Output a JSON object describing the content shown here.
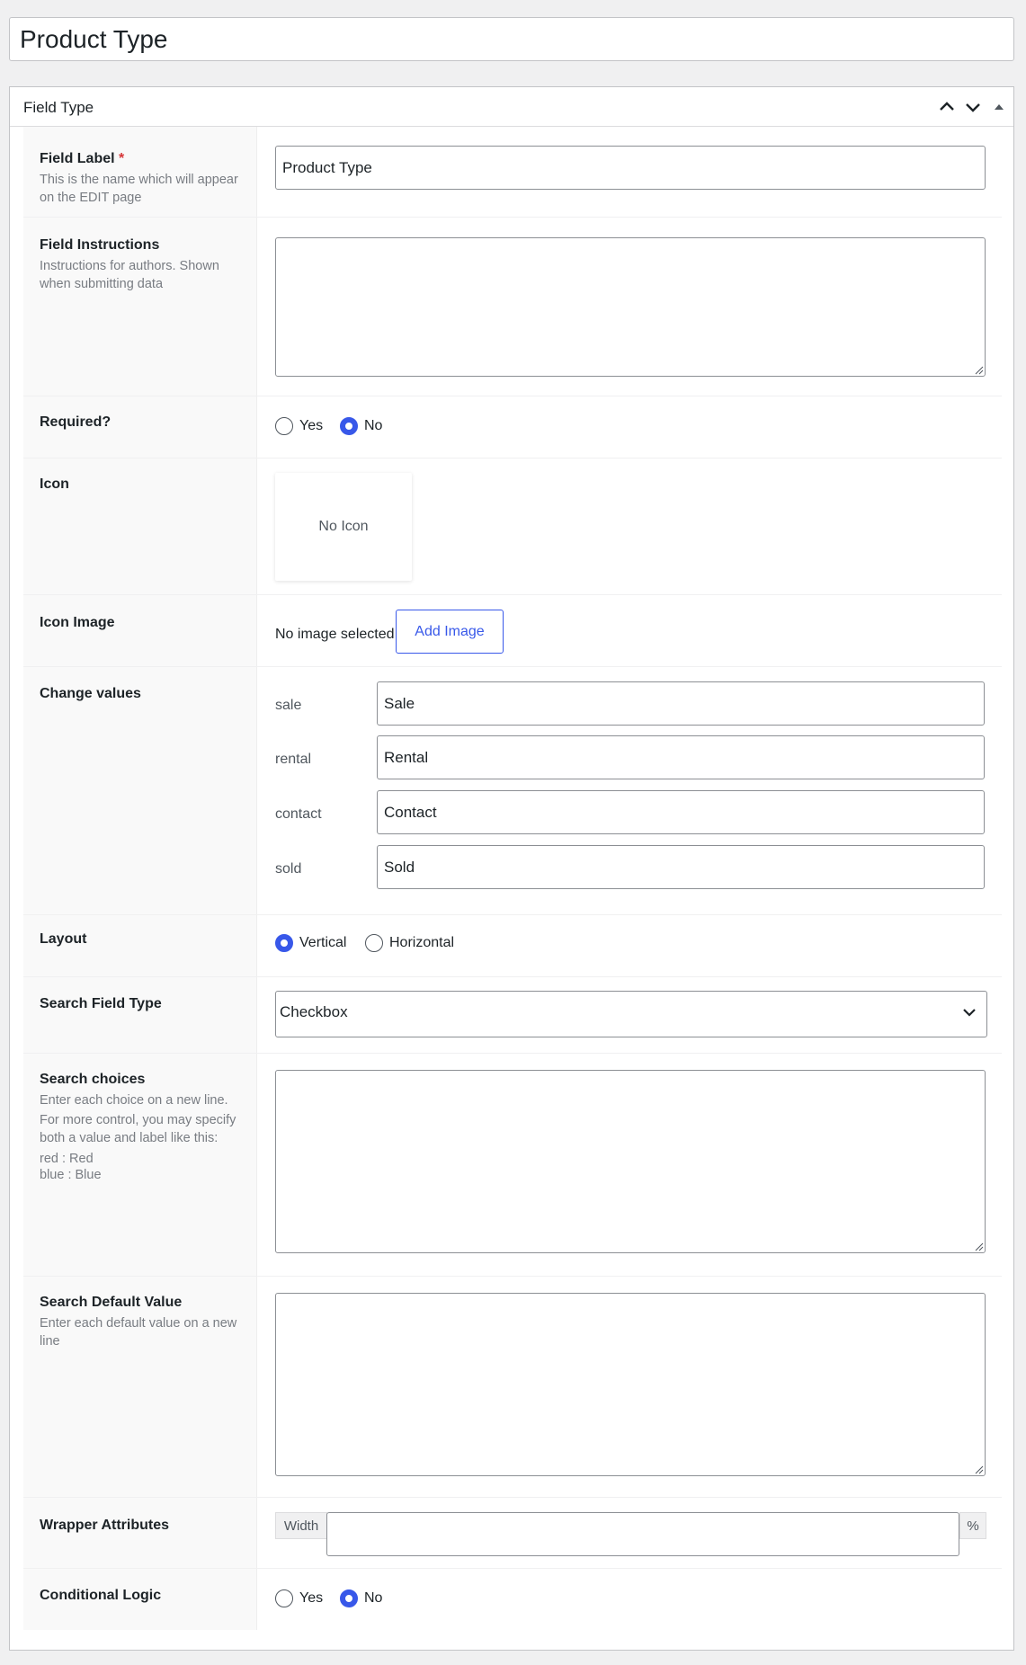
{
  "post_title": "Product Type",
  "panel": {
    "title": "Field Type"
  },
  "field_label": {
    "label": "Field Label",
    "required_mark": "*",
    "description": "This is the name which will appear on the EDIT page",
    "value": "Product Type"
  },
  "field_instructions": {
    "label": "Field Instructions",
    "description": "Instructions for authors. Shown when submitting data",
    "value": ""
  },
  "required": {
    "label": "Required?",
    "options": [
      "Yes",
      "No"
    ],
    "selected": "No"
  },
  "icon": {
    "label": "Icon",
    "placeholder": "No Icon"
  },
  "icon_image": {
    "label": "Icon Image",
    "status": "No image selected",
    "button_label": "Add Image"
  },
  "change_values": {
    "label": "Change values",
    "items": [
      {
        "key": "sale",
        "value": "Sale"
      },
      {
        "key": "rental",
        "value": "Rental"
      },
      {
        "key": "contact",
        "value": "Contact"
      },
      {
        "key": "sold",
        "value": "Sold"
      }
    ]
  },
  "layout": {
    "label": "Layout",
    "options": [
      "Vertical",
      "Horizontal"
    ],
    "selected": "Vertical"
  },
  "search_field_type": {
    "label": "Search Field Type",
    "value": "Checkbox"
  },
  "search_choices": {
    "label": "Search choices",
    "desc1": "Enter each choice on a new line.",
    "desc2": "For more control, you may specify both a value and label like this:",
    "example1": "red : Red",
    "example2": "blue : Blue",
    "value": ""
  },
  "search_default_value": {
    "label": "Search Default Value",
    "description": "Enter each default value on a new line",
    "value": ""
  },
  "wrapper_attributes": {
    "label": "Wrapper Attributes",
    "prepend": "Width",
    "append": "%",
    "value": ""
  },
  "conditional_logic": {
    "label": "Conditional Logic",
    "options": [
      "Yes",
      "No"
    ],
    "selected": "No"
  },
  "colors": {
    "accent": "#3858e9",
    "required": "#d63638"
  }
}
